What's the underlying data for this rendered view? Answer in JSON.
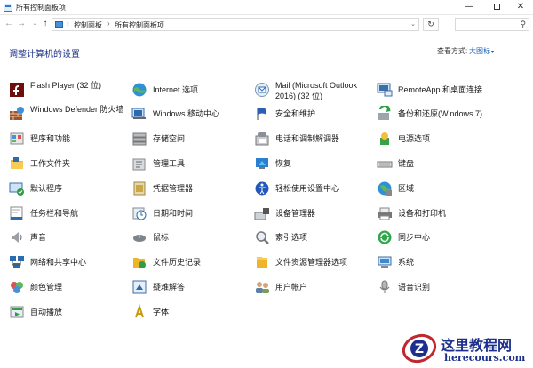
{
  "window": {
    "title": "所有控制面板项",
    "min_glyph": "—",
    "close_glyph": "✕"
  },
  "nav": {
    "back": "←",
    "forward": "→",
    "recent": "⌄",
    "up": "↑",
    "breadcrumb": [
      "控制面板",
      "所有控制面板项"
    ],
    "separator": "›",
    "dropdown": "⌄",
    "refresh": "↻",
    "search_placeholder": "",
    "search_glyph": "⚲"
  },
  "header": {
    "heading": "调整计算机的设置",
    "view_by_label": "查看方式:",
    "view_by_value": "大图标",
    "view_by_caret": "▾"
  },
  "items": [
    {
      "label": "Flash Player (32 位)",
      "icon": "flash-icon"
    },
    {
      "label": "Internet 选项",
      "icon": "globe-icon"
    },
    {
      "label": "Mail (Microsoft Outlook 2016) (32 位)",
      "icon": "mail-icon"
    },
    {
      "label": "RemoteApp 和桌面连接",
      "icon": "remoteapp-icon"
    },
    {
      "label": "Windows Defender 防火墙",
      "icon": "firewall-icon"
    },
    {
      "label": "Windows 移动中心",
      "icon": "mobility-icon"
    },
    {
      "label": "安全和维护",
      "icon": "flag-icon"
    },
    {
      "label": "备份和还原(Windows 7)",
      "icon": "backup-icon"
    },
    {
      "label": "程序和功能",
      "icon": "programs-icon"
    },
    {
      "label": "存储空间",
      "icon": "storage-icon"
    },
    {
      "label": "电话和调制解调器",
      "icon": "phone-icon"
    },
    {
      "label": "电源选项",
      "icon": "power-icon"
    },
    {
      "label": "工作文件夹",
      "icon": "folder-icon"
    },
    {
      "label": "管理工具",
      "icon": "admin-tools-icon"
    },
    {
      "label": "恢复",
      "icon": "recovery-icon"
    },
    {
      "label": "键盘",
      "icon": "keyboard-icon"
    },
    {
      "label": "默认程序",
      "icon": "default-programs-icon"
    },
    {
      "label": "凭据管理器",
      "icon": "credentials-icon"
    },
    {
      "label": "轻松使用设置中心",
      "icon": "ease-of-access-icon"
    },
    {
      "label": "区域",
      "icon": "region-icon"
    },
    {
      "label": "任务栏和导航",
      "icon": "taskbar-icon"
    },
    {
      "label": "日期和时间",
      "icon": "clock-icon"
    },
    {
      "label": "设备管理器",
      "icon": "device-manager-icon"
    },
    {
      "label": "设备和打印机",
      "icon": "printer-icon"
    },
    {
      "label": "声音",
      "icon": "speaker-icon"
    },
    {
      "label": "鼠标",
      "icon": "mouse-icon"
    },
    {
      "label": "索引选项",
      "icon": "indexing-icon"
    },
    {
      "label": "同步中心",
      "icon": "sync-icon"
    },
    {
      "label": "网络和共享中心",
      "icon": "network-icon"
    },
    {
      "label": "文件历史记录",
      "icon": "file-history-icon"
    },
    {
      "label": "文件资源管理器选项",
      "icon": "explorer-options-icon"
    },
    {
      "label": "系统",
      "icon": "system-icon"
    },
    {
      "label": "颜色管理",
      "icon": "color-icon"
    },
    {
      "label": "疑难解答",
      "icon": "troubleshoot-icon"
    },
    {
      "label": "用户帐户",
      "icon": "users-icon"
    },
    {
      "label": "语音识别",
      "icon": "microphone-icon"
    },
    {
      "label": "自动播放",
      "icon": "autoplay-icon"
    },
    {
      "label": "字体",
      "icon": "fonts-icon"
    }
  ],
  "watermark": {
    "site_name": "这里教程网",
    "url": "herecours.com",
    "logo_letter": "Z"
  }
}
